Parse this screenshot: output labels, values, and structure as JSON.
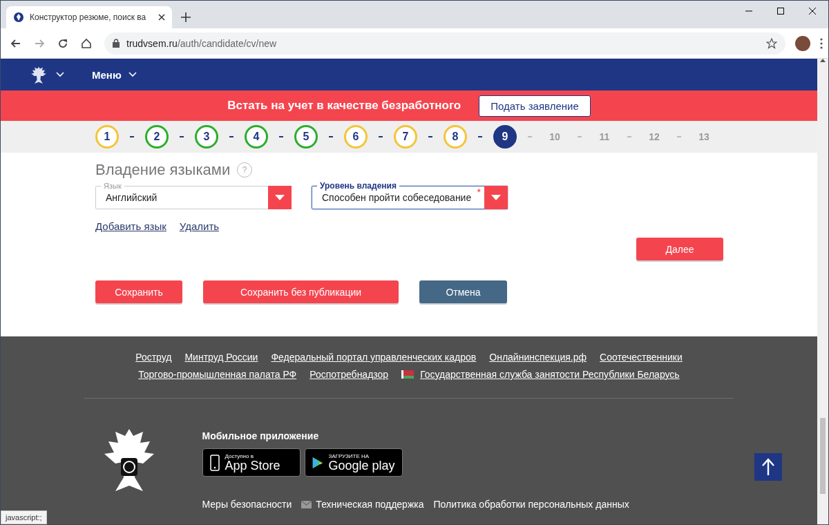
{
  "browser": {
    "tab_title": "Конструктор резюме, поиск ва",
    "url_host": "trudvsem.ru",
    "url_path": "/auth/candidate/cv/new",
    "status_text": "javascript:;"
  },
  "header": {
    "menu": "Меню"
  },
  "banner": {
    "text": "Встать на учет в качестве безработного",
    "button": "Подать заявление"
  },
  "steps": [
    {
      "label": "1",
      "kind": "partial"
    },
    {
      "label": "2",
      "kind": "done"
    },
    {
      "label": "3",
      "kind": "done"
    },
    {
      "label": "4",
      "kind": "done"
    },
    {
      "label": "5",
      "kind": "done"
    },
    {
      "label": "6",
      "kind": "partial"
    },
    {
      "label": "7",
      "kind": "partial"
    },
    {
      "label": "8",
      "kind": "partial"
    },
    {
      "label": "9",
      "kind": "current"
    },
    {
      "label": "10",
      "kind": "todo"
    },
    {
      "label": "11",
      "kind": "todo"
    },
    {
      "label": "12",
      "kind": "todo"
    },
    {
      "label": "13",
      "kind": "todo"
    }
  ],
  "section": {
    "title": "Владение языками",
    "help": "?"
  },
  "fields": [
    {
      "label": "Язык",
      "value": "Английский",
      "focused": false
    },
    {
      "label": "Уровень владения",
      "value": "Способен пройти собеседование",
      "focused": true,
      "required_mark": "*"
    }
  ],
  "links": [
    "Добавить язык",
    "Удалить"
  ],
  "next_button": "Далее",
  "actions": [
    {
      "label": "Сохранить",
      "kind": "primary"
    },
    {
      "label": "Сохранить без публикации",
      "kind": "primary"
    },
    {
      "label": "Отмена",
      "kind": "secondary"
    }
  ],
  "footer": {
    "link_rows": [
      [
        {
          "label": "Роструд",
          "flag": false
        },
        {
          "label": "Минтруд России",
          "flag": false
        },
        {
          "label": "Федеральный портал управленческих кадров",
          "flag": false
        },
        {
          "label": "Онлайнинспекция.рф",
          "flag": false
        },
        {
          "label": "Соотечественники",
          "flag": false
        }
      ],
      [
        {
          "label": "Торгово-промышленная палата РФ",
          "flag": false
        },
        {
          "label": "Роспотребнадзор",
          "flag": false
        },
        {
          "label": "Государственная служба занятости Республики Беларусь",
          "flag": true
        }
      ]
    ],
    "mobile_title": "Мобильное приложение",
    "stores": [
      {
        "kind": "apple",
        "small": "Доступно в",
        "big": "App Store"
      },
      {
        "kind": "google",
        "small": "ЗАГРУЗИТЕ НА",
        "big": "Google play"
      }
    ],
    "bottom_links": [
      {
        "label": "Меры безопасности",
        "kind": "plain"
      },
      {
        "label": "Техническая поддержка",
        "kind": "mail"
      },
      {
        "label": "Политика обработки персональных данных",
        "kind": "plain"
      }
    ]
  }
}
